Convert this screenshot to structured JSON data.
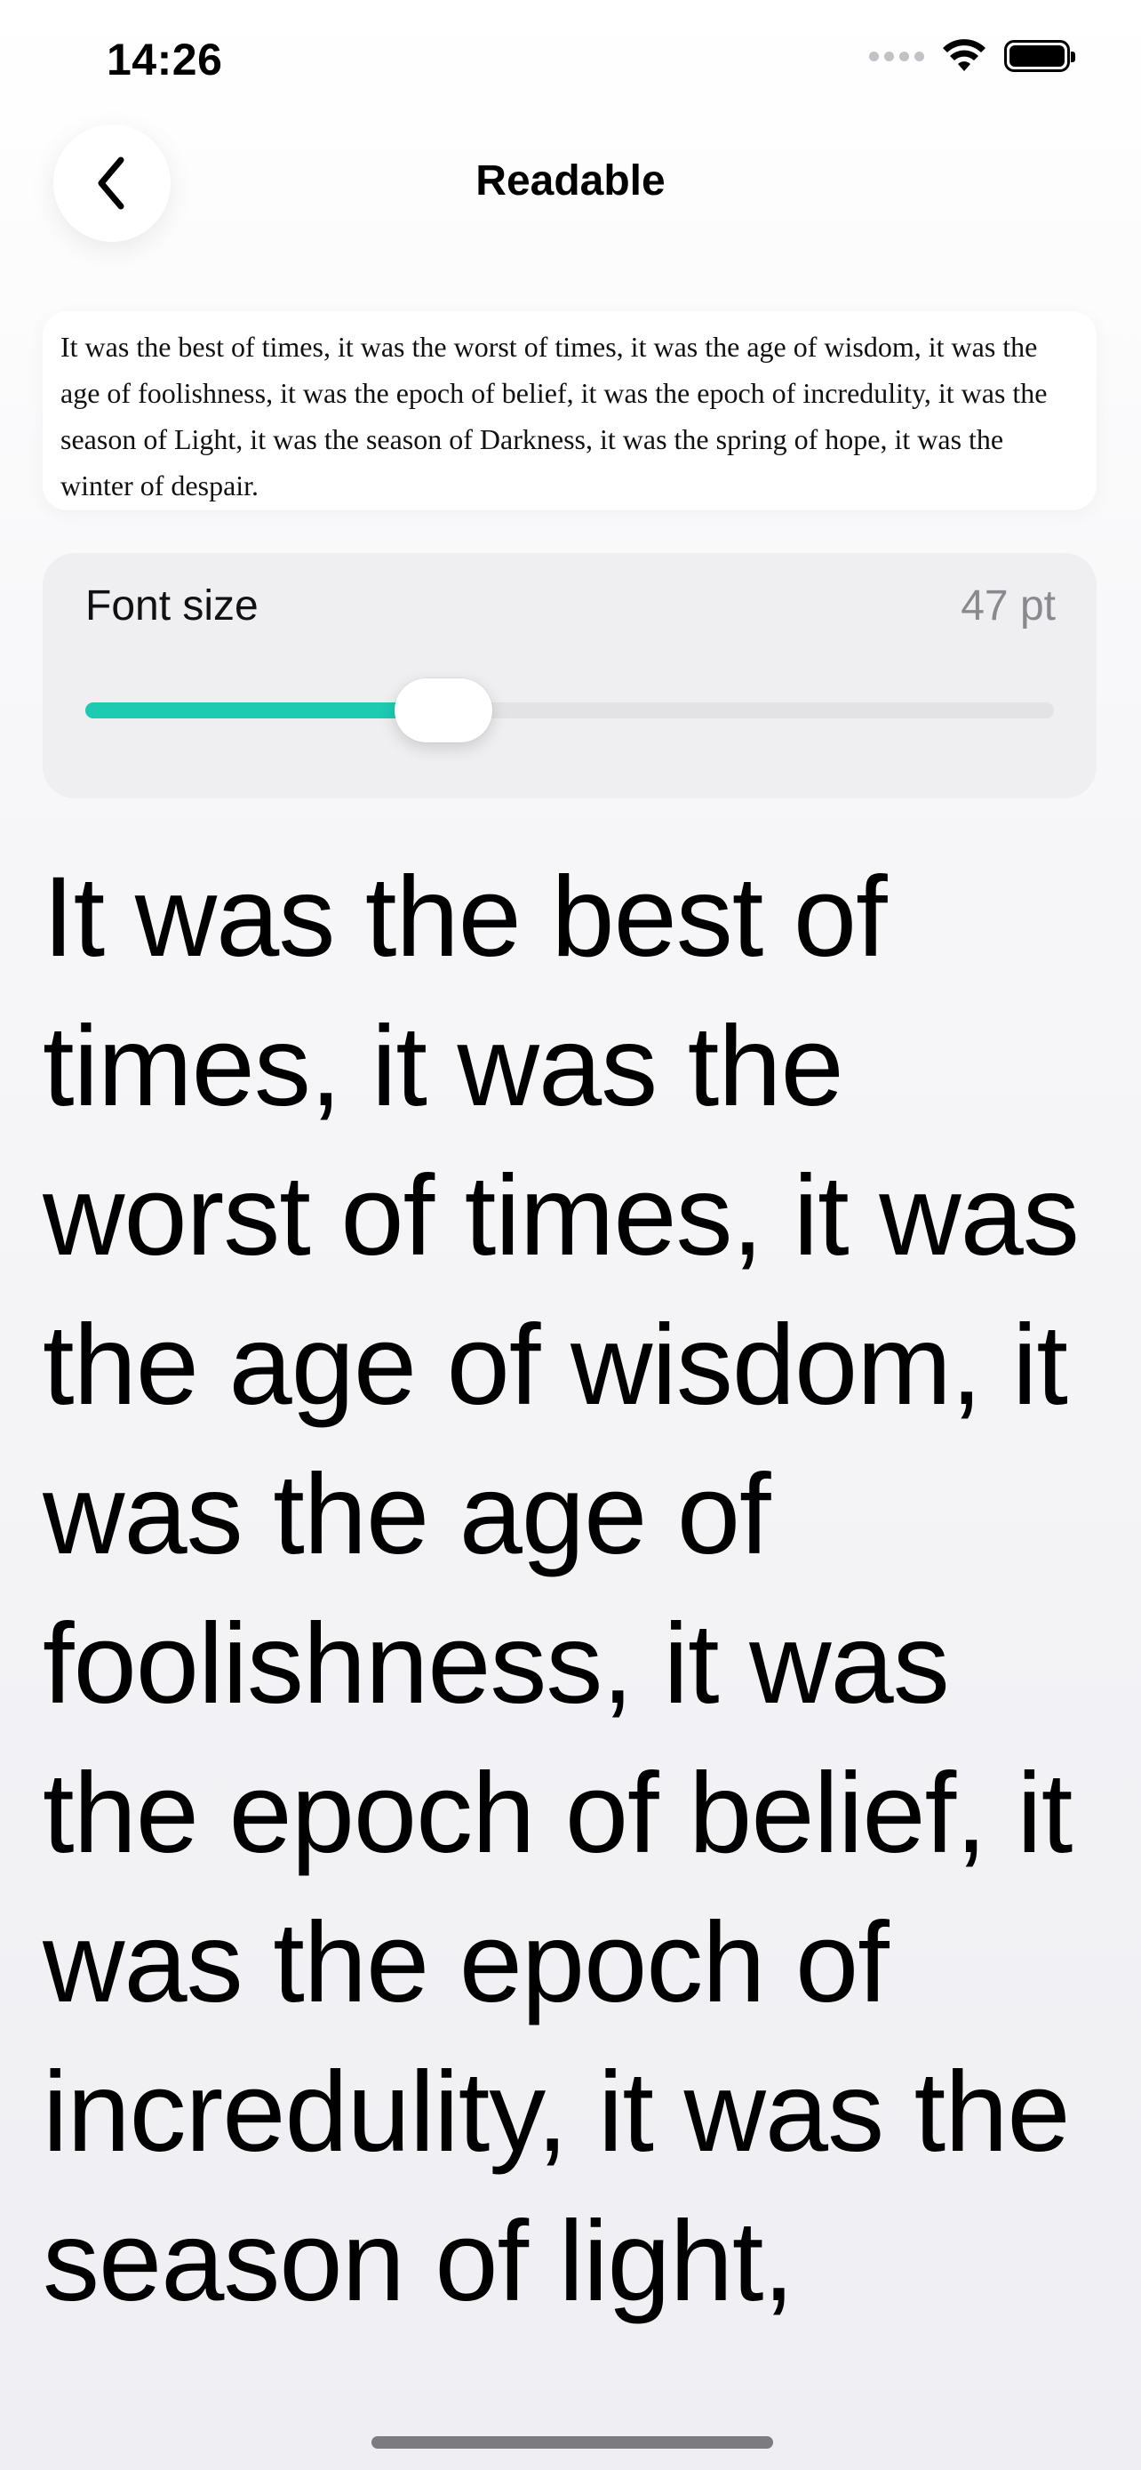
{
  "status_bar": {
    "time": "14:26"
  },
  "nav": {
    "back_icon": "chevron-left-icon",
    "title": "Readable"
  },
  "preview": {
    "text": "It was the best of times, it was the worst of times, it was the age of wisdom, it was the age of foolishness, it was the epoch of belief, it was the epoch of incredulity, it was the season of Light, it was the season of Darkness, it was the spring of hope, it was the winter of despair."
  },
  "font_size": {
    "label": "Font size",
    "value_text": "47 pt",
    "slider_fraction": 0.37,
    "accent_color": "#1ccbb2"
  },
  "reading": {
    "text": "It was the best of times, it was the worst of times, it was the age of wisdom, it was the age of foolishness, it was the epoch of belief, it was the epoch of incredulity, it was the season of light,"
  },
  "icons": {
    "signal": "cellular-signal-icon",
    "wifi": "wifi-icon",
    "battery": "battery-icon"
  }
}
